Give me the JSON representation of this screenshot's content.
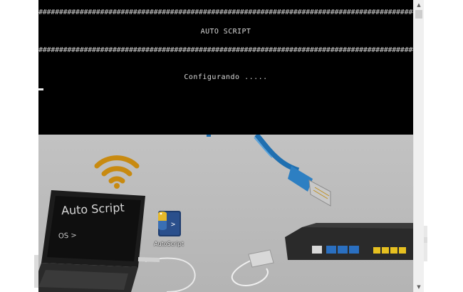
{
  "console": {
    "border_line": "#################################################################################################################",
    "title": "AUTO SCRIPT",
    "status": "Configurando ....."
  },
  "desktop": {
    "laptop_screen_title": "Auto Script",
    "laptop_screen_prompt": "OS >",
    "shortcut_icon_label": "AutoScript",
    "colors": {
      "wifi": "#c88a10",
      "cable": "#1f6fb0",
      "router_port": "#e6c020"
    }
  },
  "icons": {
    "wifi": "wifi-icon",
    "shortcut": "python-script-icon",
    "scroll_up": "chevron-up-icon",
    "scroll_down": "chevron-down-icon"
  }
}
